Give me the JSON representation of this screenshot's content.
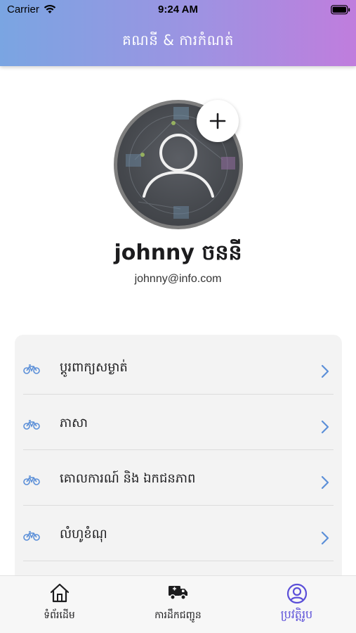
{
  "status_bar": {
    "carrier": "Carrier",
    "time": "9:24 AM"
  },
  "header": {
    "title": "គណនី & ការកំណត់"
  },
  "profile": {
    "avatar_icon": "user-silhouette-icon",
    "add_icon": "plus-icon",
    "name": "johnny ចននី",
    "email": "johnny@info.com"
  },
  "menu": {
    "items": [
      {
        "label": "ប្ដូរពាក្យសម្ងាត់",
        "icon": "bike-icon"
      },
      {
        "label": "ភាសា",
        "icon": "bike-icon"
      },
      {
        "label": "គោលការណ៍ និង ឯកជនភាព",
        "icon": "bike-icon"
      },
      {
        "label": "លំហូខំណុ",
        "icon": "bike-icon"
      }
    ]
  },
  "tab_bar": {
    "tabs": [
      {
        "label": "ទំព័រដើម",
        "icon": "home-icon"
      },
      {
        "label": "ការដឹកជញ្ជូន",
        "icon": "truck-icon"
      },
      {
        "label": "ប្រវត្តិរូប",
        "icon": "profile-icon",
        "active": true
      }
    ]
  },
  "colors": {
    "accent": "#5b4fd8",
    "icon_blue": "#5b8fd8",
    "header_gradient_start": "#7aa5e2",
    "header_gradient_end": "#c07ddd"
  }
}
